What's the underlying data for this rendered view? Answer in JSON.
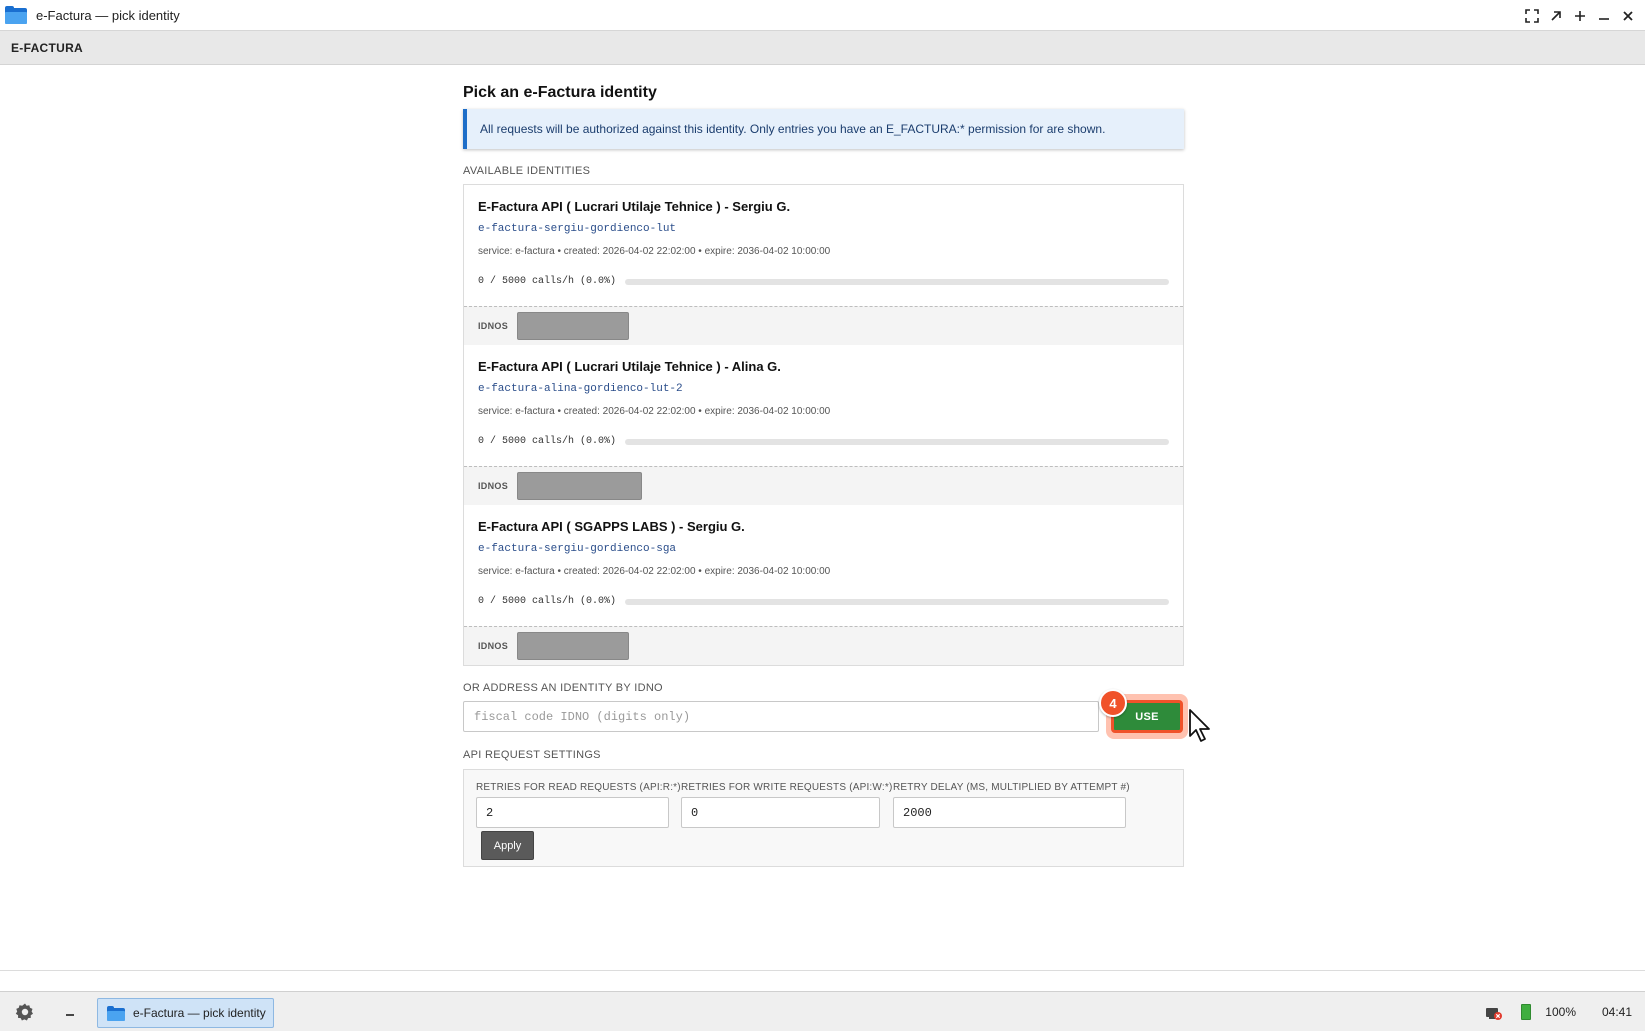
{
  "window": {
    "title": "e-Factura — pick identity",
    "icon": "folder-icon",
    "controls": [
      "fullscreen-icon",
      "restore-icon",
      "plus-icon",
      "minimize-icon",
      "close-icon"
    ]
  },
  "header": {
    "brand": "E-FACTURA"
  },
  "main": {
    "page_title": "Pick an e-Factura identity",
    "info_banner": "All requests will be authorized against this identity. Only entries you have an E_FACTURA:* permission for are shown.",
    "available_label": "AVAILABLE IDENTITIES",
    "identities": [
      {
        "name": "E-Factura API ( Lucrari Utilaje Tehnice ) - Sergiu G.",
        "slug": "e-factura-sergiu-gordienco-lut",
        "meta": "service: e-factura • created: 2026-04-02 22:02:00 • expire: 2036-04-02 10:00:00",
        "usage": "0 / 5000 calls/h (0.0%)",
        "usage_fraction": 0.0,
        "idnos_label": "IDNOS"
      },
      {
        "name": "E-Factura API ( Lucrari Utilaje Tehnice ) - Alina G.",
        "slug": "e-factura-alina-gordienco-lut-2",
        "meta": "service: e-factura • created: 2026-04-02 22:02:00 • expire: 2036-04-02 10:00:00",
        "usage": "0 / 5000 calls/h (0.0%)",
        "usage_fraction": 0.0,
        "idnos_label": "IDNOS"
      },
      {
        "name": "E-Factura API ( SGAPPS LABS ) - Sergiu G.",
        "slug": "e-factura-sergiu-gordienco-sga",
        "meta": "service: e-factura • created: 2026-04-02 22:02:00 • expire: 2036-04-02 10:00:00",
        "usage": "0 / 5000 calls/h (0.0%)",
        "usage_fraction": 0.0,
        "idnos_label": "IDNOS"
      }
    ],
    "idno_section_label": "OR ADDRESS AN IDENTITY BY IDNO",
    "idno_input": {
      "value": "",
      "placeholder": "fiscal code IDNO (digits only)"
    },
    "use_button": "USE",
    "step_badge": "4",
    "api_settings_label": "API REQUEST SETTINGS",
    "settings": {
      "read_label": "RETRIES FOR READ REQUESTS (API:R:*)",
      "read_value": "2",
      "write_label": "RETRIES FOR WRITE REQUESTS (API:W:*)",
      "write_value": "0",
      "delay_label": "RETRY DELAY (MS, MULTIPLIED BY ATTEMPT #)",
      "delay_value": "2000",
      "apply_button": "Apply"
    }
  },
  "taskbar": {
    "settings_icon": "gear-icon",
    "minimize_icon": "minimize-icon",
    "task_label": "e-Factura — pick identity",
    "battery_percent": "100%",
    "time": "04:41"
  },
  "colors": {
    "accent_blue": "#1e6ec8",
    "use_button_green": "#2e8b3a",
    "highlight_orange": "#f0522a",
    "apply_button": "#5a5a5a"
  }
}
